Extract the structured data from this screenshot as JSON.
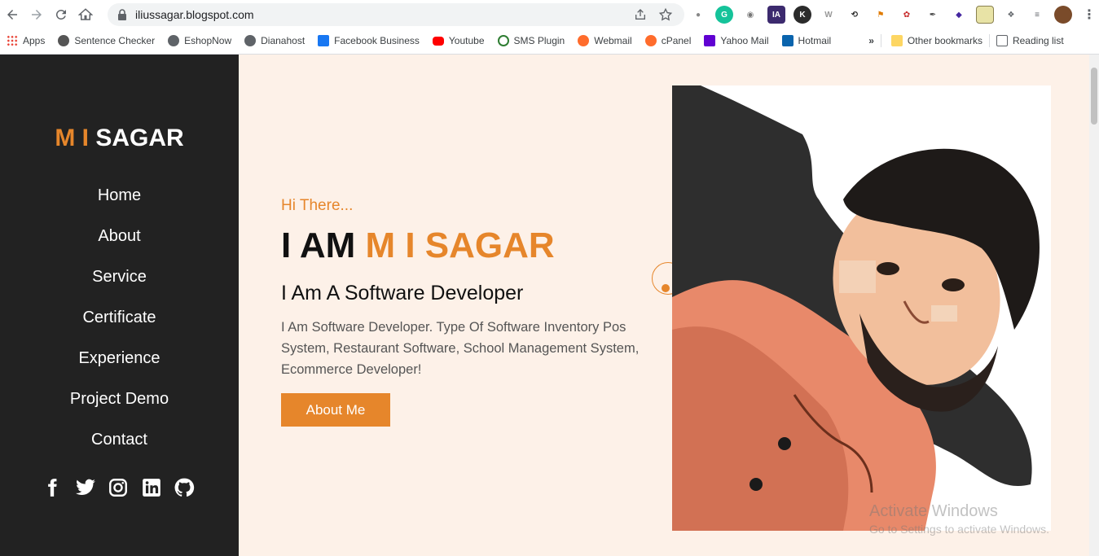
{
  "browser": {
    "url": "iliussagar.blogspot.com",
    "bookmarks": [
      {
        "label": "Apps",
        "icon": "apps-grid-icon",
        "color": "#e94235"
      },
      {
        "label": "Sentence Checker",
        "icon": "owl-icon",
        "color": "#555555"
      },
      {
        "label": "EshopNow",
        "icon": "globe-icon",
        "color": "#5f6368"
      },
      {
        "label": "Dianahost",
        "icon": "globe-icon",
        "color": "#5f6368"
      },
      {
        "label": "Facebook Business",
        "icon": "facebook-icon",
        "color": "#1877f2"
      },
      {
        "label": "Youtube",
        "icon": "youtube-icon",
        "color": "#ff0000"
      },
      {
        "label": "SMS Plugin",
        "icon": "sms-plugin-icon",
        "color": "#2e7d32"
      },
      {
        "label": "Webmail",
        "icon": "cpanel-icon",
        "color": "#ff6c2c"
      },
      {
        "label": "cPanel",
        "icon": "cpanel-icon",
        "color": "#ff6c2c"
      },
      {
        "label": "Yahoo Mail",
        "icon": "yahoo-mail-icon",
        "color": "#6001d2"
      },
      {
        "label": "Hotmail",
        "icon": "outlook-icon",
        "color": "#0a64ad"
      }
    ],
    "overflow_label": "»",
    "other_bookmarks": "Other bookmarks",
    "reading_list": "Reading list"
  },
  "site": {
    "logo_accent": "M I",
    "logo_main": "SAGAR",
    "accent_color": "#e6862b",
    "nav": [
      "Home",
      "About",
      "Service",
      "Certificate",
      "Experience",
      "Project Demo",
      "Contact"
    ],
    "social": [
      "facebook-icon",
      "twitter-icon",
      "instagram-icon",
      "linkedin-icon",
      "github-icon"
    ]
  },
  "hero": {
    "greeting": "Hi There...",
    "headline_prefix": "I AM",
    "headline_name": "M I SAGAR",
    "subtitle": "I Am A Software Developer",
    "description": "I Am Software Developer. Type Of Software Inventory Pos System, Restaurant Software, School Management System, Ecommerce Developer!",
    "button": "About Me"
  },
  "watermark": {
    "line1": "Activate Windows",
    "line2": "Go to Settings to activate Windows."
  }
}
